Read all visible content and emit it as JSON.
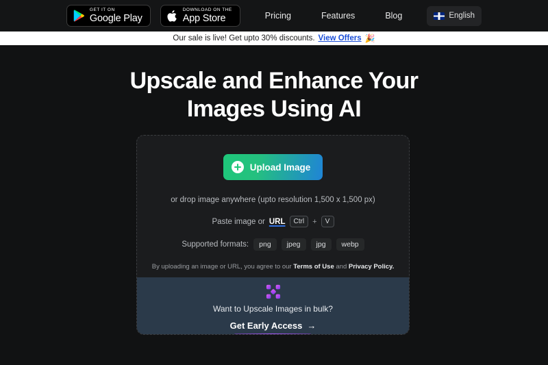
{
  "nav": {
    "store_badges": [
      {
        "icon": "google-play-icon",
        "small": "GET IT ON",
        "big": "Google Play"
      },
      {
        "icon": "apple-icon",
        "small": "Download on the",
        "big": "App Store"
      }
    ],
    "links": [
      "Pricing",
      "Features",
      "Blog"
    ],
    "language": {
      "icon": "uk-flag-icon",
      "label": "English"
    }
  },
  "announcement": {
    "message": "Our sale is live! Get upto 30% discounts.",
    "link": "View Offers",
    "emoji": "🎉"
  },
  "hero": {
    "title_line1": "Upscale and Enhance Your",
    "title_line2": "Images Using AI"
  },
  "upload": {
    "button_label": "Upload Image",
    "button_icon": "plus-circle-icon",
    "drop_hint": "or drop image anywhere (upto resolution 1,500 x 1,500 px)",
    "paste_prefix": "Paste image or",
    "paste_url": "URL",
    "key_ctrl": "Ctrl",
    "key_plus": "+",
    "key_v": "V",
    "formats_label": "Supported formats:",
    "formats": [
      "png",
      "jpeg",
      "jpg",
      "webp"
    ],
    "terms_prefix": "By uploading an image or URL, you agree to our",
    "terms_of_use": "Terms of Use",
    "terms_and": "and",
    "privacy_policy": "Privacy Policy.",
    "accent_gradient_from": "#1ec77a",
    "accent_gradient_to": "#1f84d6"
  },
  "bulk": {
    "icon": "bulk-upscale-icon",
    "title": "Want to Upscale Images in bulk?",
    "cta": "Get Early Access",
    "cta_arrow": "→",
    "panel_color": "#2b3a4a",
    "accent_color": "#a855f7"
  }
}
